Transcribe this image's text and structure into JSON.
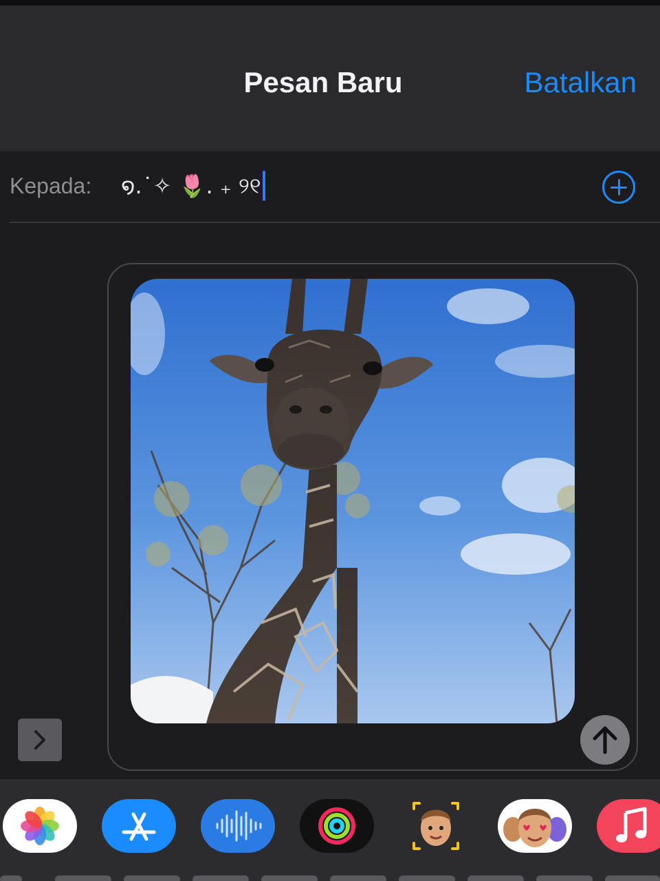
{
  "header": {
    "title": "Pesan Baru",
    "cancel_label": "Batalkan"
  },
  "recipient": {
    "label": "Kepada:",
    "value": "໑.˙✧ 🌷. ₊ ୨୧"
  },
  "attachment": {
    "type": "photo",
    "subject": "giraffe"
  },
  "icons": {
    "add_contact": "plus-circle-icon",
    "expand": "chevron-right-icon",
    "send": "arrow-up-icon"
  },
  "colors": {
    "accent": "#1a8cff",
    "caret": "#3478f6",
    "background": "#1c1c1e",
    "nav_background": "#2a2a2c",
    "send_button": "#7c7c80"
  },
  "app_tray": [
    {
      "name": "Photos",
      "icon": "photos-icon"
    },
    {
      "name": "App Store",
      "icon": "app-store-icon"
    },
    {
      "name": "Audio Message",
      "icon": "audio-waveform-icon"
    },
    {
      "name": "Activity",
      "icon": "activity-rings-icon"
    },
    {
      "name": "Memoji",
      "icon": "memoji-icon"
    },
    {
      "name": "Memoji Stickers",
      "icon": "memoji-stickers-icon"
    },
    {
      "name": "Music",
      "icon": "music-note-icon"
    }
  ]
}
